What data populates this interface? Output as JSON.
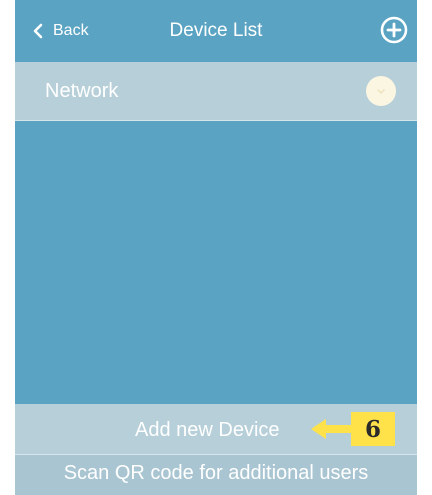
{
  "header": {
    "back_label": "Back",
    "title": "Device List",
    "add_icon": "plus-circle-icon"
  },
  "network": {
    "label": "Network",
    "toggle_icon": "toggle-knob-icon"
  },
  "footer": {
    "add_device_label": "Add new Device",
    "scan_label": "Scan QR code for additional users"
  },
  "callout": {
    "number": "6"
  },
  "colors": {
    "background": "#5aa3c3",
    "row": "#b7cfd9",
    "callout": "#ffe14a"
  }
}
